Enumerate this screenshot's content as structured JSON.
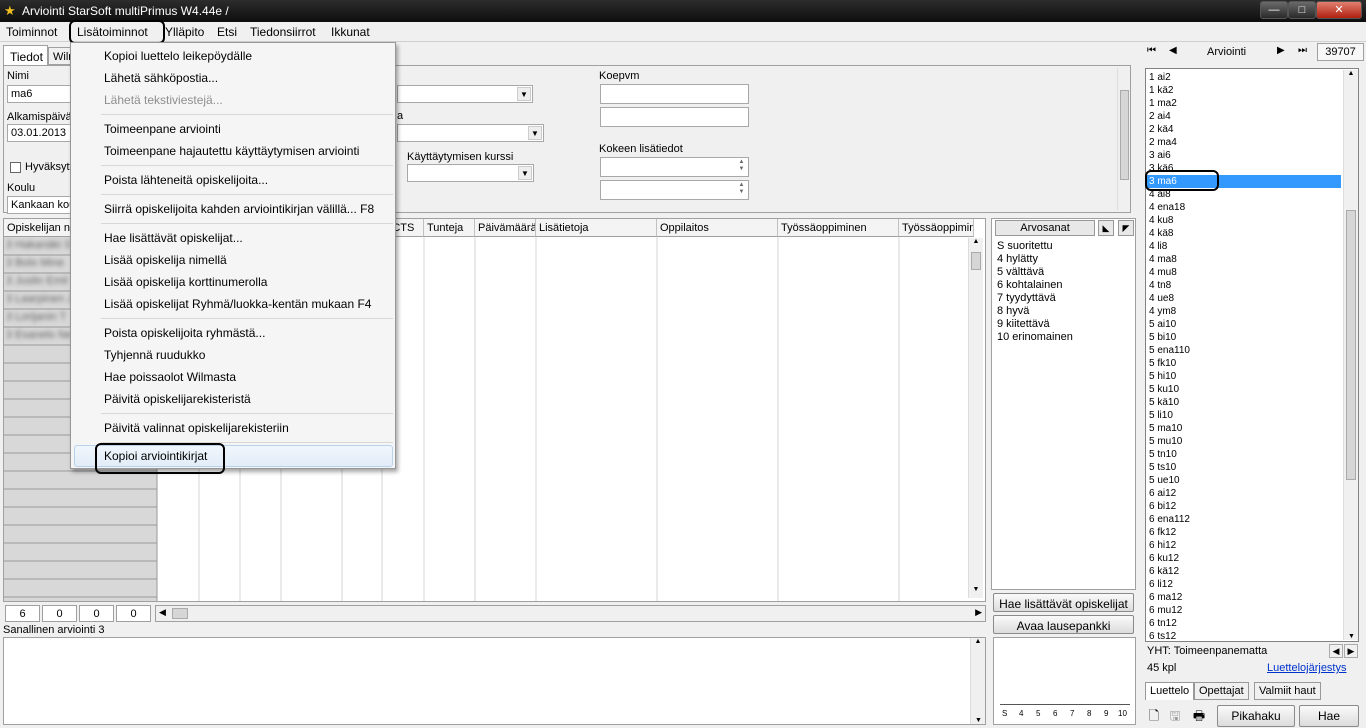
{
  "window": {
    "title": "Arviointi StarSoft multiPrimus W4.44e /"
  },
  "menubar": [
    "Toiminnot",
    "Lisätoiminnot",
    "Ylläpito",
    "Etsi",
    "Tiedonsiirrot",
    "Ikkunat"
  ],
  "tabs": {
    "tiedot": "Tiedot",
    "wilma": "Wilma"
  },
  "form": {
    "nimi_label": "Nimi",
    "nimi_value": "ma6",
    "alkamis_label": "Alkamispäivä",
    "alkamis_value": "03.01.2013",
    "hyvaksytty": "Hyväksytty",
    "koulu_label": "Koulu",
    "koulu_value": "Kankaan koulu",
    "partial_a": "a",
    "kaytt_kurssi_label": "Käyttäytymisen kurssi",
    "koepvm_label": "Koepvm",
    "kokeen_label": "Kokeen lisätiedot"
  },
  "grid": {
    "headers": [
      "Opiskelijan nimi",
      "ECTS",
      "Tunteja",
      "Päivämäärä",
      "Lisätietoja",
      "Oppilaitos",
      "Työssäoppiminen",
      "Työssäoppiminen"
    ],
    "rows": [
      "3 Hakanäki S",
      "3 Bolo Mine",
      "3 Juslin Emil",
      "3 Laarpinen J",
      "3 Lorijanin T",
      "3 Esanelo Ne"
    ]
  },
  "counts": [
    "6",
    "0",
    "0",
    "0"
  ],
  "sanallinen_label": "Sanallinen arviointi 3",
  "arvosanat": {
    "header": "Arvosanat",
    "grades": [
      "S suoritettu",
      "4 hylätty",
      "5 välttävä",
      "6 kohtalainen",
      "7 tyydyttävä",
      "8 hyvä",
      "9 kiitettävä",
      "10 erinomainen"
    ],
    "btn_hae": "Hae lisättävät opiskelijat",
    "btn_avaa": "Avaa lausepankki",
    "scale": [
      "S",
      "4",
      "5",
      "6",
      "7",
      "8",
      "9",
      "10"
    ]
  },
  "nav": {
    "label": "Arviointi",
    "count": "39707"
  },
  "list": {
    "items": [
      "1 ai2",
      "1 kä2",
      "1 ma2",
      "2 ai4",
      "2 kä4",
      "2 ma4",
      "3 ai6",
      "3 kä6",
      "3 ma6",
      "4 ai8",
      "4 ena18",
      "4 ku8",
      "4 kä8",
      "4 li8",
      "4 ma8",
      "4 mu8",
      "4 tn8",
      "4 ue8",
      "4 ym8",
      "5 ai10",
      "5 bi10",
      "5 ena110",
      "5 fk10",
      "5 hi10",
      "5 ku10",
      "5 kä10",
      "5 li10",
      "5 ma10",
      "5 mu10",
      "5 tn10",
      "5 ts10",
      "5 ue10",
      "6 ai12",
      "6 bi12",
      "6 ena112",
      "6 fk12",
      "6 hi12",
      "6 ku12",
      "6 kä12",
      "6 li12",
      "6 ma12",
      "6 mu12",
      "6 tn12",
      "6 ts12"
    ],
    "selected_index": 8,
    "yht": "YHT: Toimeenpanematta",
    "kpl": "45 kpl",
    "jarjestys": "Luettelojärjestys"
  },
  "bottom_tabs": [
    "Luettelo",
    "Opettajat",
    "Valmiit haut"
  ],
  "toolbar": {
    "pikahaku": "Pikahaku",
    "hae": "Hae"
  },
  "dropdown": {
    "items": [
      {
        "label": "Kopioi luettelo leikepöydälle"
      },
      {
        "label": "Lähetä sähköpostia..."
      },
      {
        "label": "Lähetä tekstiviestejä...",
        "disabled": true
      },
      {
        "label": "Toimeenpane arviointi"
      },
      {
        "label": "Toimeenpane hajautettu käyttäytymisen arviointi"
      },
      {
        "label": "Poista lähteneitä opiskelijoita..."
      },
      {
        "label": "Siirrä opiskelijoita kahden arviointikirjan välillä...  F8"
      },
      {
        "label": "Hae lisättävät opiskelijat..."
      },
      {
        "label": "Lisää opiskelija nimellä"
      },
      {
        "label": "Lisää opiskelija korttinumerolla"
      },
      {
        "label": "Lisää opiskelijat Ryhmä/luokka-kentän mukaan  F4"
      },
      {
        "label": "Poista opiskelijoita ryhmästä..."
      },
      {
        "label": "Tyhjennä ruudukko"
      },
      {
        "label": "Hae poissaolot Wilmasta"
      },
      {
        "label": "Päivitä opiskelijarekisteristä"
      },
      {
        "label": "Päivitä valinnat opiskelijarekisteriin"
      },
      {
        "label": "Kopioi arviointikirjat"
      }
    ]
  }
}
